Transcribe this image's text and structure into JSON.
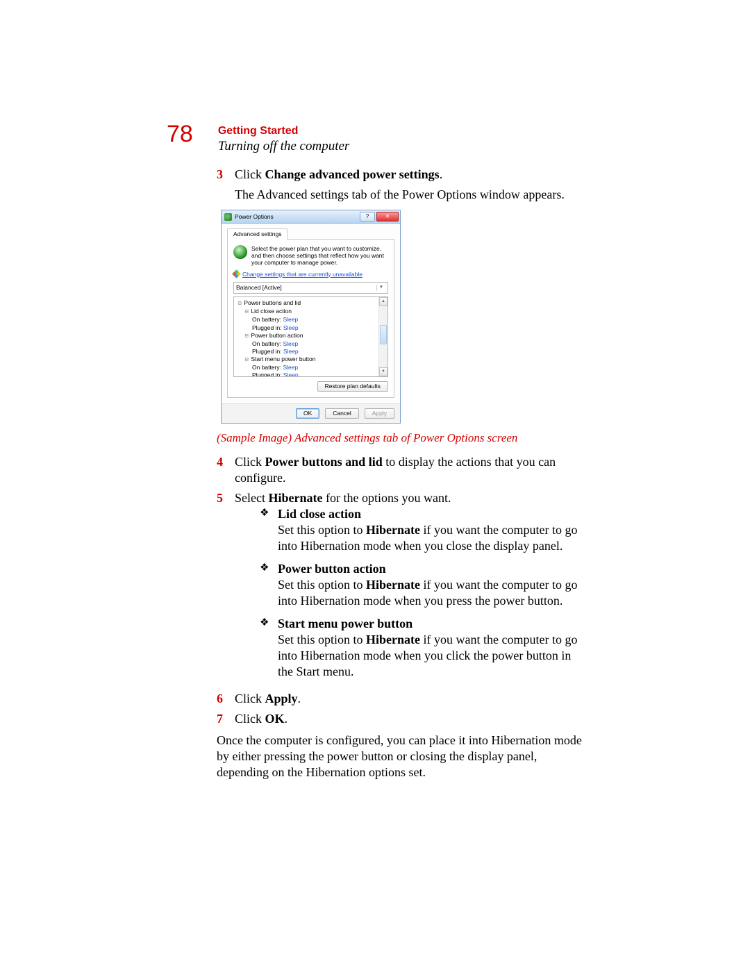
{
  "page_number": "78",
  "chapter": "Getting Started",
  "section": "Turning off the computer",
  "step3_num": "3",
  "step3_a": "Click ",
  "step3_b": "Change advanced power settings",
  "step3_c": ".",
  "step3_sub": "The Advanced settings tab of the Power Options window appears.",
  "caption": "(Sample Image) Advanced settings tab of Power Options screen",
  "step4_num": "4",
  "step4_a": "Click ",
  "step4_b": "Power buttons and lid",
  "step4_c": " to display the actions that you can configure.",
  "step5_num": "5",
  "step5_a": "Select ",
  "step5_b": "Hibernate",
  "step5_c": " for the options you want.",
  "b1_title": "Lid close action",
  "b1_a": "Set this option to ",
  "b1_b": "Hibernate",
  "b1_c": " if you want the computer to go into Hibernation mode when you close the display panel.",
  "b2_title": "Power button action",
  "b2_a": "Set this option to ",
  "b2_b": "Hibernate",
  "b2_c": " if you want the computer to go into Hibernation mode when you press the power button.",
  "b3_title": "Start menu power button",
  "b3_a": "Set this option to ",
  "b3_b": "Hibernate",
  "b3_c": " if you want the computer to go into Hibernation mode when you click the power button in the Start menu.",
  "step6_num": "6",
  "step6_a": "Click ",
  "step6_b": "Apply",
  "step6_c": ".",
  "step7_num": "7",
  "step7_a": "Click ",
  "step7_b": "OK",
  "step7_c": ".",
  "closing": "Once the computer is configured, you can place it into Hibernation mode by either pressing the power button or closing the display panel, depending on the Hibernation options set.",
  "dlg": {
    "title": "Power Options",
    "tab": "Advanced settings",
    "desc": "Select the power plan that you want to customize, and then choose settings that reflect how you want your computer to manage power.",
    "link": "Change settings that are currently unavailable",
    "plan": "Balanced [Active]",
    "tree": {
      "root": "Power buttons and lid",
      "lid": "Lid close action",
      "lid_bat_k": "On battery:",
      "lid_bat_v": "Sleep",
      "lid_plug_k": "Plugged in:",
      "lid_plug_v": "Sleep",
      "pwr": "Power button action",
      "pwr_bat_k": "On battery:",
      "pwr_bat_v": "Sleep",
      "pwr_plug_k": "Plugged in:",
      "pwr_plug_v": "Sleep",
      "start": "Start menu power button",
      "start_bat_k": "On battery:",
      "start_bat_v": "Sleep",
      "start_plug_k": "Plugged in:",
      "start_plug_v": "Sleep"
    },
    "restore": "Restore plan defaults",
    "ok": "OK",
    "cancel": "Cancel",
    "apply": "Apply"
  }
}
